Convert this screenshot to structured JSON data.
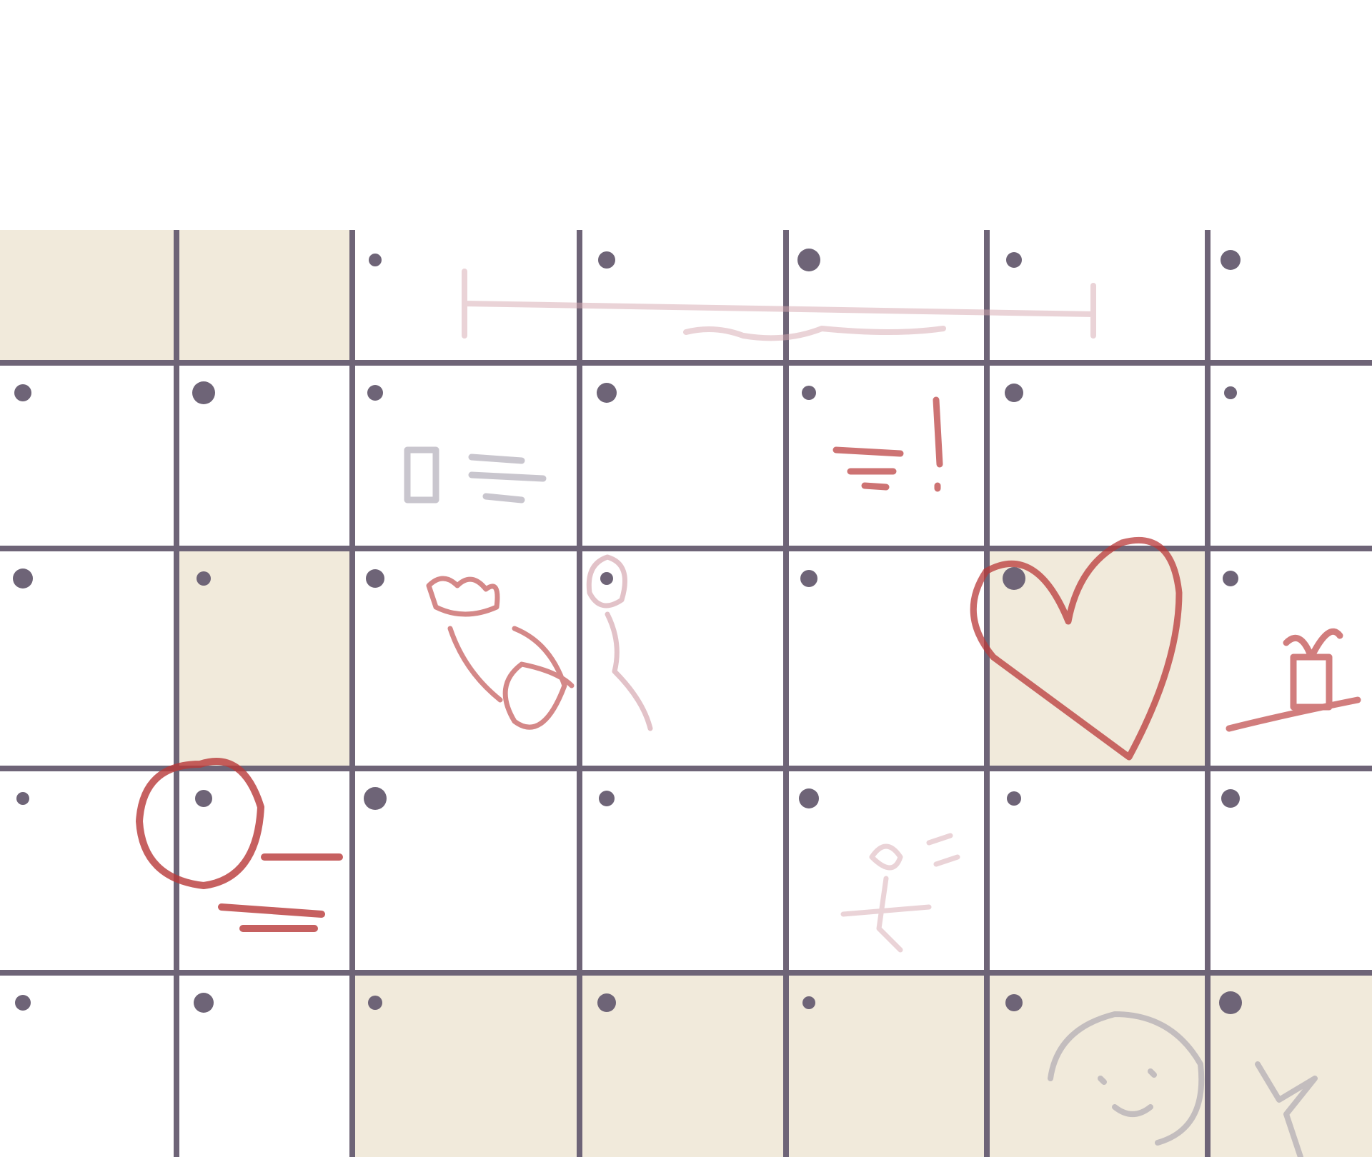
{
  "calendar": {
    "header_color": "#6e6477",
    "line_color": "#6e6477",
    "shade_color": "#f1eadb",
    "paper_color": "#ffffff",
    "ink_red": "#b83838",
    "ink_pink": "#d6a8b0",
    "ink_gray": "#9d98a6",
    "rows": [
      {
        "shaded": [
          true,
          true,
          false,
          false,
          false,
          false,
          false
        ]
      },
      {
        "shaded": [
          false,
          false,
          false,
          false,
          false,
          false,
          false
        ]
      },
      {
        "shaded": [
          false,
          true,
          false,
          false,
          false,
          true,
          false
        ]
      },
      {
        "shaded": [
          false,
          false,
          false,
          false,
          false,
          false,
          false
        ]
      },
      {
        "shaded": [
          false,
          false,
          true,
          true,
          true,
          true,
          true
        ]
      }
    ],
    "doodles": [
      {
        "name": "bracket-scribble-doodle",
        "row": 0,
        "color": "ink_pink"
      },
      {
        "name": "notes-scribble-doodle",
        "row": 1,
        "color": "ink_gray"
      },
      {
        "name": "exclamation-note-doodle",
        "row": 1,
        "color": "ink_red"
      },
      {
        "name": "flower-bouquet-doodle",
        "row": 2,
        "color": "ink_red"
      },
      {
        "name": "balloon-doodle",
        "row": 2,
        "color": "ink_pink"
      },
      {
        "name": "heart-doodle",
        "row": 2,
        "color": "ink_red"
      },
      {
        "name": "gift-doodle",
        "row": 2,
        "color": "ink_red"
      },
      {
        "name": "circled-date-doodle",
        "row": 3,
        "color": "ink_red"
      },
      {
        "name": "person-doodle",
        "row": 3,
        "color": "ink_pink"
      },
      {
        "name": "face-stars-doodle",
        "row": 4,
        "color": "ink_gray"
      }
    ]
  }
}
